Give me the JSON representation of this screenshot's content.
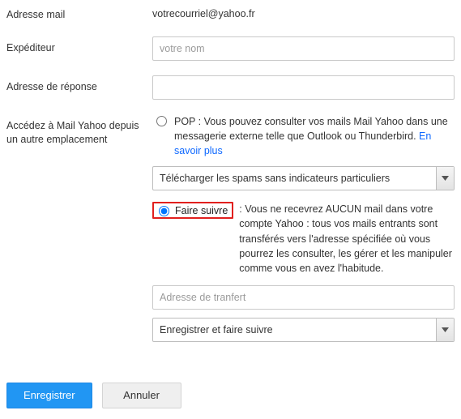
{
  "fields": {
    "email_label": "Adresse mail",
    "email_value": "votrecourriel@yahoo.fr",
    "sender_label": "Expéditeur",
    "sender_placeholder": "votre nom",
    "sender_value": "",
    "reply_label": "Adresse de réponse",
    "reply_value": ""
  },
  "access": {
    "label": "Accédez à Mail Yahoo depuis un autre emplacement",
    "pop": {
      "head": "POP :",
      "desc": " Vous pouvez consulter vos mails Mail Yahoo dans une messagerie externe telle que Outlook ou Thunderbird. ",
      "link": "En savoir plus",
      "select_value": "Télécharger les spams sans indicateurs particuliers"
    },
    "forward": {
      "head": "Faire suivre",
      "desc_lead": " :",
      "desc": " Vous ne recevrez AUCUN mail dans votre compte Yahoo : tous vos mails entrants sont transférés vers l'adresse spécifiée où vous pourrez les consulter, les gérer et les manipuler comme vous en avez l'habitude.",
      "input_placeholder": "Adresse de tranfert",
      "input_value": "",
      "select_value": "Enregistrer et faire suivre"
    }
  },
  "buttons": {
    "save": "Enregistrer",
    "cancel": "Annuler"
  }
}
